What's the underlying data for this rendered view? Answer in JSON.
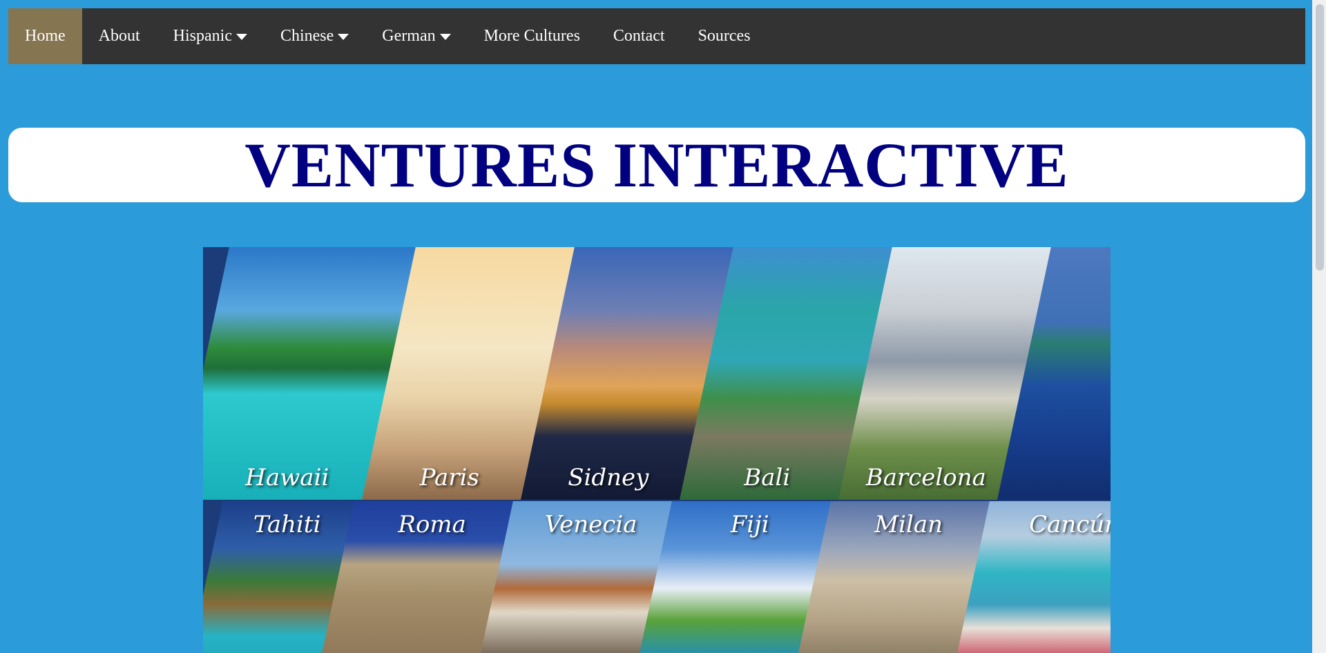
{
  "nav": {
    "items": [
      {
        "label": "Home",
        "active": true,
        "dropdown": false
      },
      {
        "label": "About",
        "active": false,
        "dropdown": false
      },
      {
        "label": "Hispanic",
        "active": false,
        "dropdown": true
      },
      {
        "label": "Chinese",
        "active": false,
        "dropdown": true
      },
      {
        "label": "German",
        "active": false,
        "dropdown": true
      },
      {
        "label": "More Cultures",
        "active": false,
        "dropdown": false
      },
      {
        "label": "Contact",
        "active": false,
        "dropdown": false
      },
      {
        "label": "Sources",
        "active": false,
        "dropdown": false
      }
    ]
  },
  "banner": {
    "title": "VENTURES INTERACTIVE"
  },
  "collage": {
    "top_row": [
      "Hawaii",
      "Paris",
      "Sidney",
      "Bali",
      "Barcelona",
      ""
    ],
    "bottom_row": [
      "Tahiti",
      "Roma",
      "Venecia",
      "Fiji",
      "Milan",
      "Cancún"
    ]
  },
  "colors": {
    "page_background": "#2b9bda",
    "nav_background": "#333333",
    "nav_active": "#857551",
    "title_color": "#000080"
  }
}
